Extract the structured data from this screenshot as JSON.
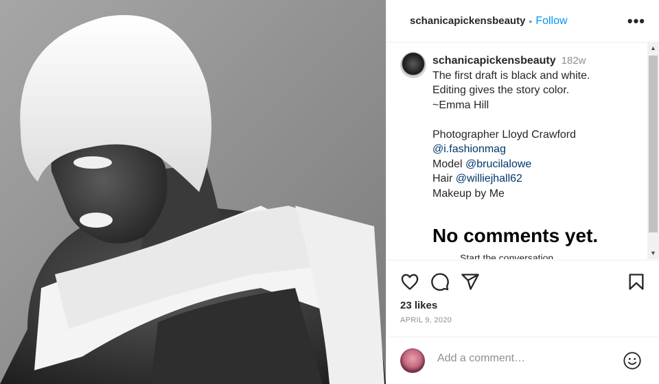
{
  "post": {
    "username": "schanicapickensbeauty",
    "separator": "•",
    "follow_label": "Follow",
    "more_label": "•••"
  },
  "caption": {
    "username": "schanicapickensbeauty",
    "time": "182w",
    "lines": [
      "The first draft is black and white.",
      "Editing gives the story color.",
      "~Emma Hill"
    ],
    "credits": [
      {
        "label": "Photographer Lloyd Crawford",
        "mention": ""
      },
      {
        "label": "",
        "mention": "@i.fashionmag"
      },
      {
        "label": "Model ",
        "mention": "@brucilalowe"
      },
      {
        "label": "Hair ",
        "mention": "@williejhall62"
      },
      {
        "label": "Makeup by Me",
        "mention": ""
      }
    ]
  },
  "comments": {
    "empty_title": "No comments yet.",
    "empty_subtitle": "Start the conversation."
  },
  "actions": {
    "icons": [
      "heart-icon",
      "comment-icon",
      "share-icon",
      "bookmark-icon"
    ],
    "likes": "23 likes",
    "date": "APRIL 9, 2020"
  },
  "composer": {
    "placeholder": "Add a comment…",
    "emoji_icon": "smiley-icon"
  },
  "colors": {
    "accent": "#0095f6",
    "mention": "#00376b",
    "muted": "#8e8e8e"
  }
}
